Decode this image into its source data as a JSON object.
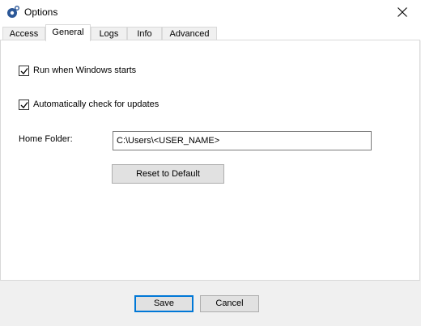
{
  "window": {
    "title": "Options",
    "icon": "app-gear-icon",
    "close_icon": "close-icon"
  },
  "tabs": [
    {
      "label": "Access",
      "active": false
    },
    {
      "label": "General",
      "active": true
    },
    {
      "label": "Logs",
      "active": false
    },
    {
      "label": "Info",
      "active": false
    },
    {
      "label": "Advanced",
      "active": false
    }
  ],
  "general": {
    "run_on_startup": {
      "label": "Run when Windows starts",
      "checked": true
    },
    "auto_update": {
      "label": "Automatically check for updates",
      "checked": true
    },
    "home_folder": {
      "label": "Home Folder:",
      "value": "C:\\Users\\<USER_NAME>"
    },
    "reset_label": "Reset to Default"
  },
  "footer": {
    "save_label": "Save",
    "cancel_label": "Cancel"
  },
  "colors": {
    "accent": "#0078d7",
    "app_icon": "#2b5797",
    "button_face": "#e1e1e1"
  }
}
